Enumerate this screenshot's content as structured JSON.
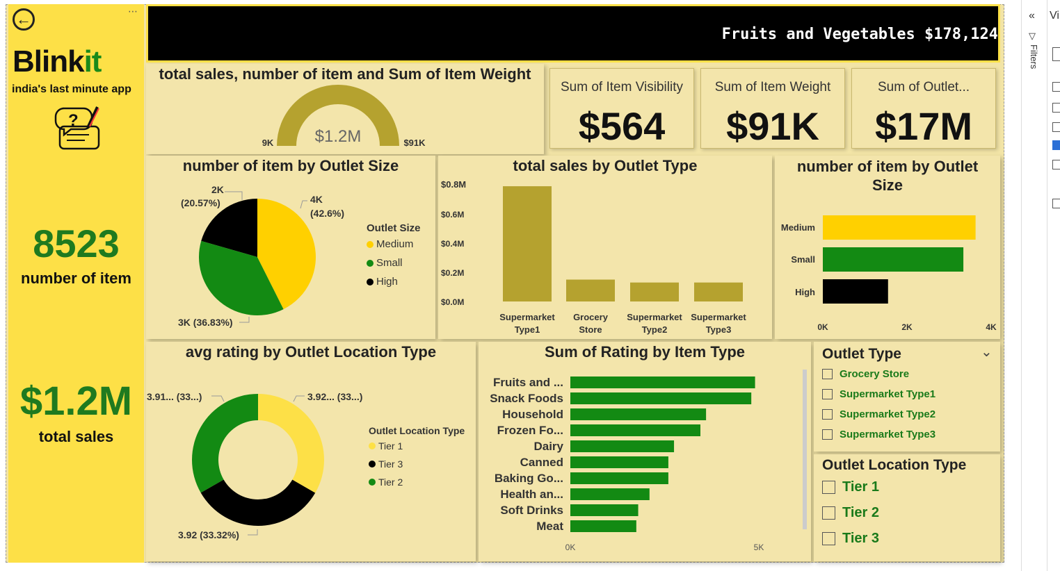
{
  "sidebar": {
    "brand_main": "Blink",
    "brand_accent": "it",
    "tagline": "india's last minute app",
    "item_count": "8523",
    "item_count_label": "number of item",
    "total_sales": "$1.2M",
    "total_sales_label": "total sales"
  },
  "ticker": {
    "text": "Fruits and Vegetables $178,124"
  },
  "gauge": {
    "title": "total sales, number of item and Sum of Item Weight",
    "value": "$1.2M",
    "min": "9K",
    "max": "$91K"
  },
  "kpis": [
    {
      "label": "Sum of Item Visibility",
      "value": "$564"
    },
    {
      "label": "Sum of Item Weight",
      "value": "$91K"
    },
    {
      "label": "Sum of Outlet...",
      "value": "$17M"
    }
  ],
  "pie_size": {
    "title": "number of item by Outlet Size",
    "legend_title": "Outlet Size",
    "legend": [
      "Medium",
      "Small",
      "High"
    ],
    "label_medium": "4K",
    "label_medium_pct": "(42.6%)",
    "label_high": "2K",
    "label_high_pct": "(20.57%)",
    "label_small": "3K (36.83%)"
  },
  "bar_type": {
    "title": "total sales by Outlet Type",
    "y_ticks": [
      "$0.8M",
      "$0.6M",
      "$0.4M",
      "$0.2M",
      "$0.0M"
    ],
    "cat1a": "Supermarket",
    "cat1b": "Type1",
    "cat2a": "Grocery",
    "cat2b": "Store",
    "cat3a": "Supermarket",
    "cat3b": "Type2",
    "cat4a": "Supermarket",
    "cat4b": "Type3"
  },
  "hbar_size": {
    "title": "number of item by Outlet Size",
    "cats": [
      "Medium",
      "Small",
      "High"
    ],
    "ticks": [
      "0K",
      "2K",
      "4K"
    ]
  },
  "donut": {
    "title": "avg rating by Outlet Location Type",
    "legend_title": "Outlet Location Type",
    "legend": [
      "Tier 1",
      "Tier 3",
      "Tier 2"
    ],
    "label_tl": "3.91... (33...)",
    "label_tr": "3.92... (33...)",
    "label_b": "3.92 (33.32%)"
  },
  "rating_bar": {
    "title": "Sum of Rating by Item Type",
    "x_ticks": [
      "0K",
      "5K"
    ]
  },
  "slicer_type": {
    "title": "Outlet Type",
    "items": [
      "Grocery Store",
      "Supermarket Type1",
      "Supermarket Type2",
      "Supermarket Type3"
    ]
  },
  "slicer_loc": {
    "title": "Outlet Location Type",
    "items": [
      "Tier 1",
      "Tier 2",
      "Tier 3"
    ]
  },
  "right_pane": {
    "title": "Vi",
    "filters": "Filters"
  },
  "colors": {
    "yellow": "#fde047",
    "gold": "#ffd000",
    "green": "#138a13",
    "black": "#000000",
    "olive": "#b5a22f"
  },
  "chart_data": [
    {
      "type": "pie",
      "title": "number of item by Outlet Size",
      "categories": [
        "Medium",
        "Small",
        "High"
      ],
      "values": [
        42.6,
        36.83,
        20.57
      ]
    },
    {
      "type": "bar",
      "title": "total sales by Outlet Type",
      "categories": [
        "Supermarket Type1",
        "Grocery Store",
        "Supermarket Type2",
        "Supermarket Type3"
      ],
      "values": [
        0.79,
        0.15,
        0.13,
        0.13
      ],
      "ylim": [
        0,
        0.8
      ]
    },
    {
      "type": "bar",
      "title": "number of item by Outlet Size",
      "categories": [
        "Medium",
        "Small",
        "High"
      ],
      "values": [
        3.63,
        3.34,
        1.55
      ],
      "xlim": [
        0,
        4
      ]
    },
    {
      "type": "pie",
      "title": "avg rating by Outlet Location Type",
      "categories": [
        "Tier 1",
        "Tier 3",
        "Tier 2"
      ],
      "values": [
        33.34,
        33.34,
        33.32
      ]
    },
    {
      "type": "bar",
      "title": "Sum of Rating by Item Type",
      "categories": [
        "Fruits and ...",
        "Snack Foods",
        "Household",
        "Frozen Fo...",
        "Dairy",
        "Canned",
        "Baking Go...",
        "Health an...",
        "Soft Drinks",
        "Meat"
      ],
      "values": [
        4.9,
        4.8,
        3.6,
        3.45,
        2.75,
        2.6,
        2.6,
        2.1,
        1.8,
        1.75
      ],
      "xlim": [
        0,
        5
      ]
    }
  ]
}
